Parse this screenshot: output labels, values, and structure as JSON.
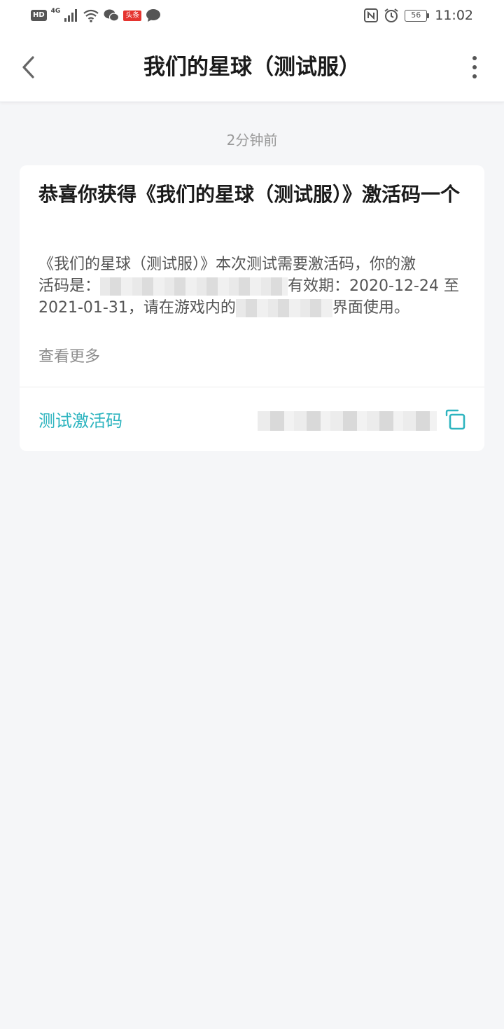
{
  "status_bar": {
    "hd": "HD",
    "network": "4G",
    "news_badge": "头条",
    "battery": "56",
    "time": "11:02"
  },
  "nav": {
    "title": "我们的星球（测试服）"
  },
  "message": {
    "timestamp": "2分钟前",
    "title": "恭喜你获得《我们的星球（测试服）》激活码一个",
    "body_line1": "《我们的星球（测试服）》本次测试需要激活码，你的激",
    "body_line2_prefix": "活码是：",
    "body_line2_suffix": "有效期：2020-12-24 至",
    "body_line3_prefix": "2021-01-31，请在游戏内的",
    "body_line3_suffix": "界面使用。",
    "see_more": "查看更多",
    "code_label": "测试激活码"
  },
  "colors": {
    "accent": "#2db4bf",
    "background": "#f5f6f8",
    "card": "#ffffff"
  },
  "icons": [
    "back-chevron-icon",
    "more-vertical-icon",
    "copy-icon",
    "nfc-icon",
    "alarm-icon",
    "wifi-icon",
    "signal-icon",
    "wechat-icon",
    "message-icon",
    "battery-icon"
  ]
}
